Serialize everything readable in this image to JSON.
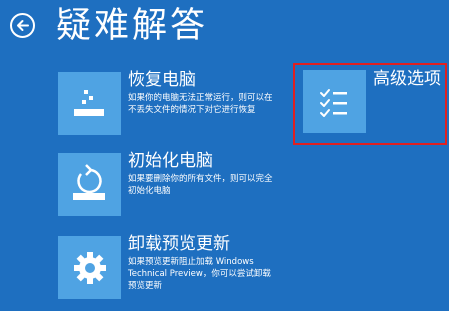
{
  "page": {
    "title": "疑难解答",
    "back_icon": "back-arrow-icon"
  },
  "options": {
    "refresh": {
      "title": "恢复电脑",
      "description": "如果你的电脑无法正常运行，则可以在不丢失文件的情况下对它进行恢复",
      "icon": "refresh-pc-icon"
    },
    "reset": {
      "title": "初始化电脑",
      "description": "如果要删除你的所有文件，则可以完全初始化电脑",
      "icon": "reset-pc-icon"
    },
    "uninstall": {
      "title": "卸载预览更新",
      "description": "如果预览更新阻止加载 Windows Technical Preview，你可以尝试卸载预览更新",
      "icon": "gear-icon"
    },
    "advanced": {
      "title": "高级选项",
      "icon": "checklist-icon"
    }
  },
  "colors": {
    "background": "#1e6fc0",
    "tile": "#4fa3e3",
    "text": "#ffffff",
    "highlight": "#e02020"
  }
}
